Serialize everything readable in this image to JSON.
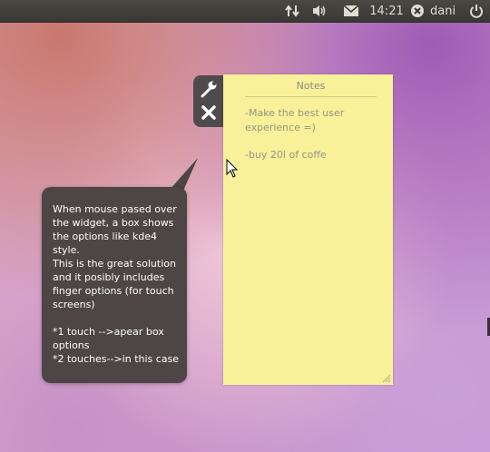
{
  "panel": {
    "clock": "14:21",
    "user": "dani",
    "icons": [
      "network-arrows-icon",
      "volume-icon",
      "mail-icon",
      "user-status-icon",
      "power-icon"
    ]
  },
  "widget": {
    "options": [
      "wrench-icon",
      "close-icon"
    ]
  },
  "note": {
    "title": "Notes",
    "line1": "-Make the best user experience =)",
    "line2": "-buy 20l of coffe"
  },
  "callout": {
    "text": "When mouse pased over the widget, a box shows the options like kde4 style.\nThis is the great solution and it posibly includes finger options (for touch screens)\n\n*1 touch -->apear box options\n*2 touches-->in this case"
  },
  "colors": {
    "panel": "#3a3834",
    "note": "#f8f19a",
    "callout": "#4d4546",
    "options_box": "#4f4a4b"
  }
}
